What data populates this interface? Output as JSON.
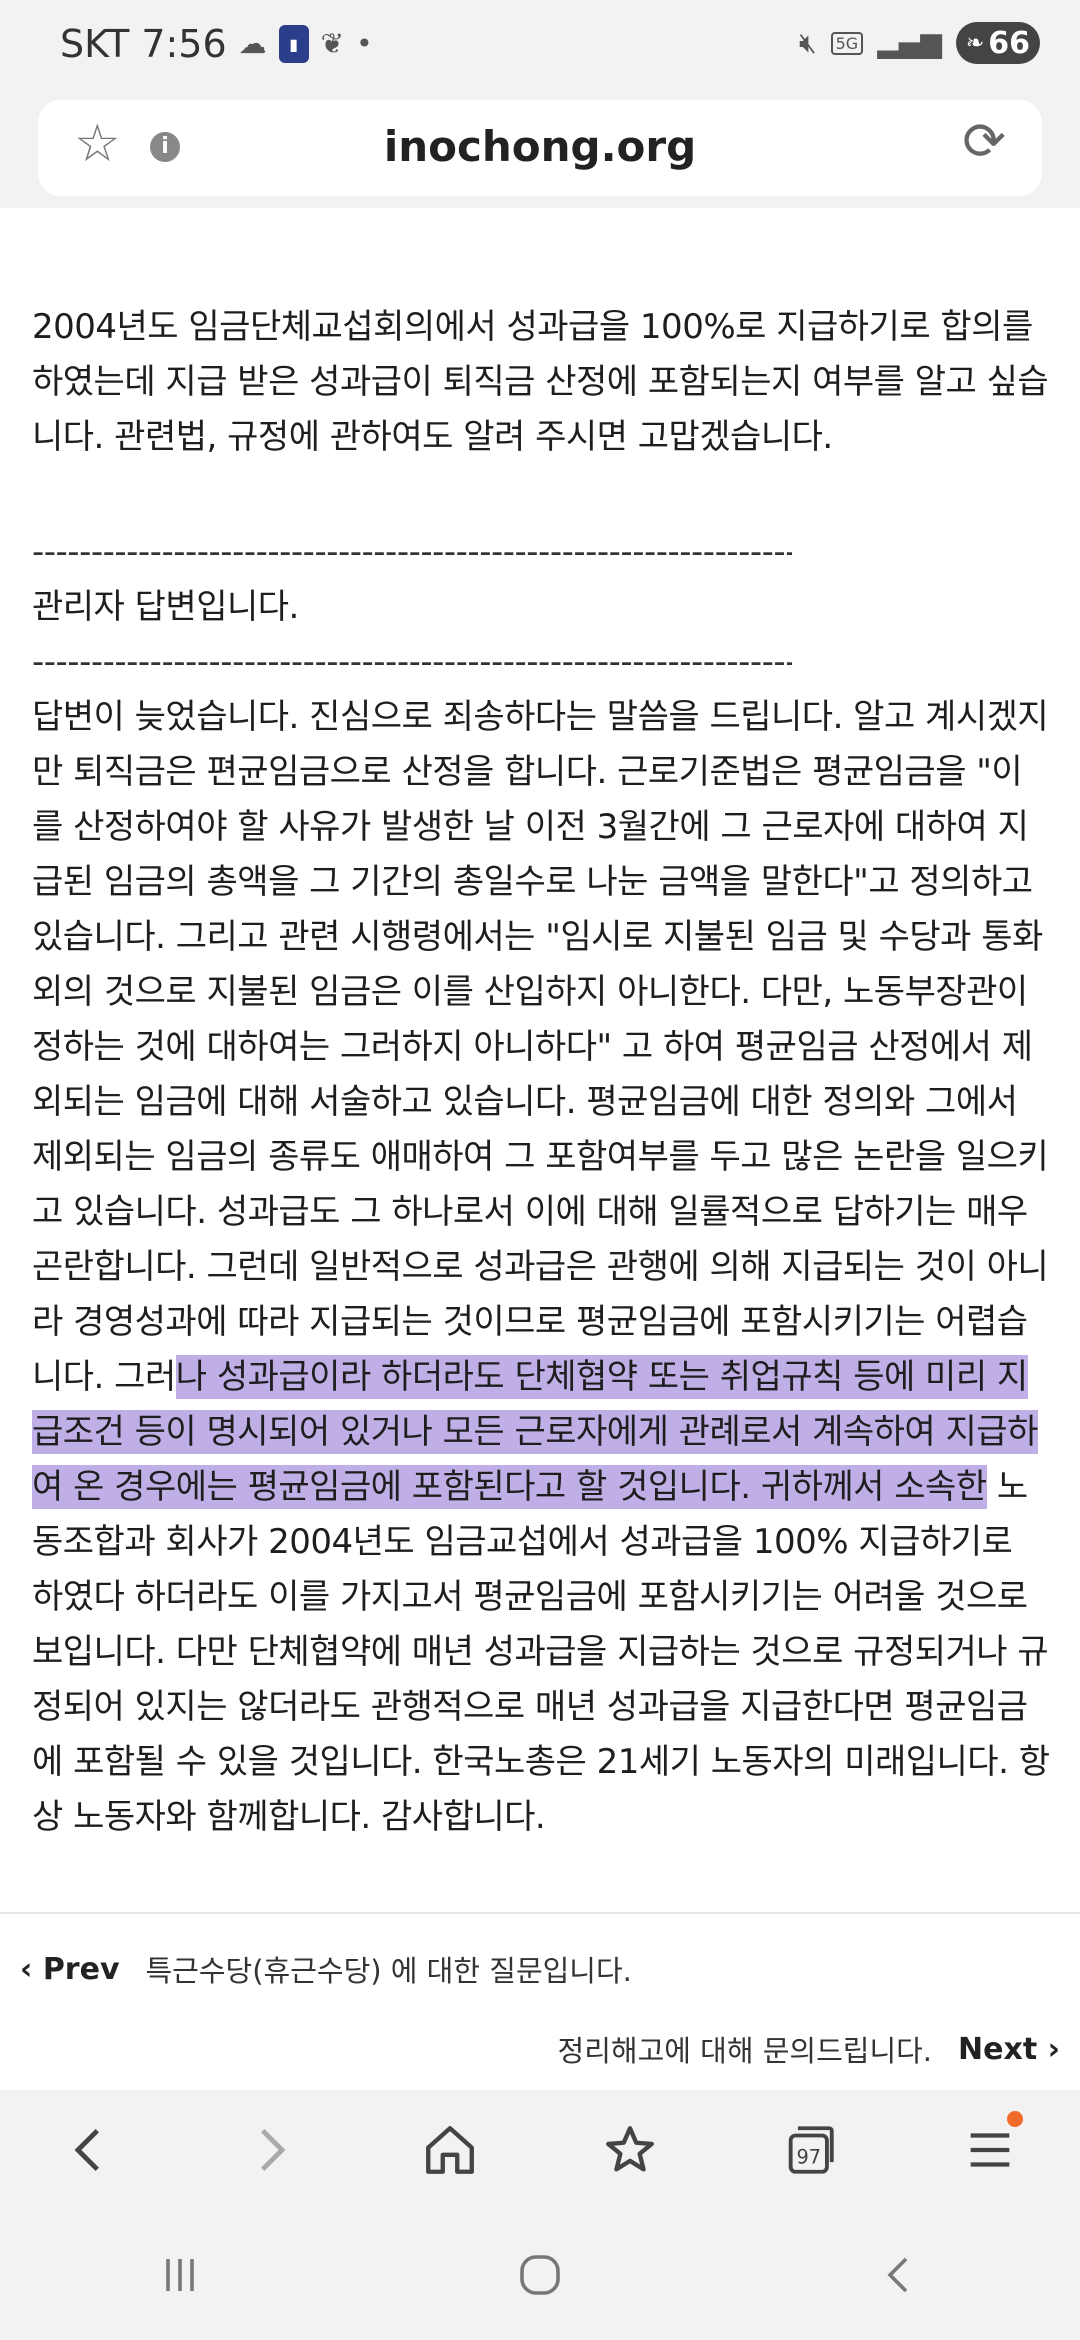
{
  "status_bar": {
    "carrier": "SKT",
    "time": "7:56",
    "network": "5G",
    "battery": "66"
  },
  "browser": {
    "domain": "inochong.org"
  },
  "article": {
    "question": "2004년도 임금단체교섭회의에서 성과급을 100%로 지급하기로 합의를 하였는데 지급 받은 성과급이 퇴직금 산정에 포함되는지 여부를 알고 싶습니다. 관련법, 규정에 관하여도 알려 주시면 고맙겠습니다.",
    "divider": "------------------------------------------------------------------------------------------------------",
    "admin_label": "관리자 답변입니다.",
    "answer_part1": "답변이 늦었습니다. 진심으로 죄송하다는 말씀을 드립니다. 알고 계시겠지만 퇴직금은 편균임금으로 산정을 합니다. 근로기준법은 평균임금을 \"이를 산정하여야 할 사유가 발생한 날 이전 3월간에 그 근로자에 대하여 지급된 임금의 총액을 그 기간의 총일수로 나눈 금액을 말한다\"고 정의하고 있습니다. 그리고 관련 시행령에서는 \"임시로 지불된 임금 및 수당과 통화외의 것으로 지불된 임금은 이를 산입하지 아니한다. 다만, 노동부장관이 정하는 것에 대하여는 그러하지 아니하다\" 고 하여 평균임금 산정에서 제외되는 임금에 대해 서술하고 있습니다. 평균임금에 대한 정의와 그에서 제외되는 임금의 종류도 애매하여 그 포함여부를 두고 많은 논란을 일으키고 있습니다. 성과급도 그 하나로서 이에 대해 일률적으로 답하기는 매우 곤란합니다. 그런데 일반적으로 성과급은 관행에 의해 지급되는 것이 아니라 경영성과에 따라 지급되는 것이므로 평균임금에 포함시키기는 어렵습니다. 그러",
    "answer_highlight": "나 성과급이라 하더라도 단체협약 또는 취업규칙 등에 미리 지급조건 등이 명시되어 있거나 모든 근로자에게 관례로서 계속하여 지급하여 온 경우에는 평균임금에 포함된다고 할 것입니다. 귀하께서 소속한",
    "answer_part2": " 노동조합과 회사가 2004년도 임금교섭에서 성과급을 100% 지급하기로 하였다 하더라도 이를 가지고서 평균임금에 포함시키기는 어려울 것으로 보입니다. 다만 단체협약에 매년 성과급을 지급하는 것으로 규정되거나 규정되어 있지는 않더라도 관행적으로 매년 성과급을 지급한다면 평균임금에 포함될 수 있을 것입니다. 한국노총은 21세기 노동자의 미래입니다. 항상 노동자와 함께합니다. 감사합니다."
  },
  "navigation": {
    "prev_label": "Prev",
    "prev_title": "특근수당(휴근수당) 에 대한 질문입니다.",
    "next_label": "Next",
    "next_title": "정리해고에 대해 문의드립니다."
  },
  "toolbar": {
    "tabs_count": "97"
  },
  "colors": {
    "highlight": "#8c6ed2",
    "menu_dot": "#f06a2a"
  }
}
